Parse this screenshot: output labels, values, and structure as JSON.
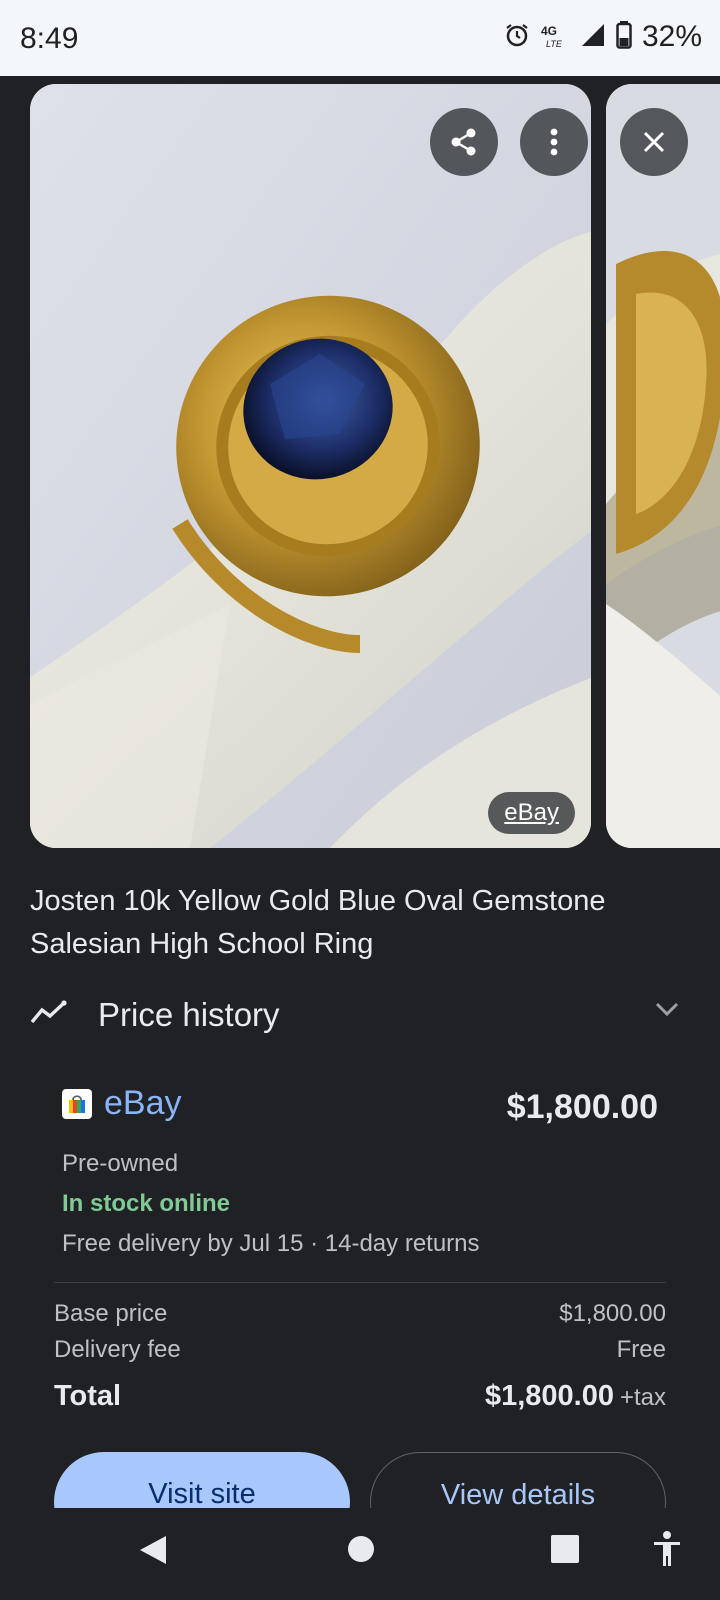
{
  "status_bar": {
    "time": "8:49",
    "network": "4G LTE",
    "battery": "32%",
    "icons": [
      "alarm-icon",
      "lte-icon",
      "signal-icon",
      "battery-icon"
    ]
  },
  "carousel": {
    "badge": "eBay",
    "actions": [
      "share-icon",
      "more-vert-icon",
      "close-icon"
    ]
  },
  "product": {
    "title": "Josten 10k Yellow Gold Blue Oval Gemstone Salesian High School Ring"
  },
  "price_history": {
    "label": "Price history",
    "icon": "trend-icon"
  },
  "offer": {
    "seller": "eBay",
    "price": "$1,800.00",
    "condition": "Pre-owned",
    "stock": "In stock online",
    "delivery": "Free delivery by Jul 15 · 14-day returns",
    "breakdown": {
      "base_label": "Base price",
      "base_value": "$1,800.00",
      "delivery_label": "Delivery fee",
      "delivery_value": "Free",
      "total_label": "Total",
      "total_value": "$1,800.00",
      "tax": "+tax"
    },
    "buttons": {
      "visit": "Visit site",
      "details": "View details"
    }
  },
  "colors": {
    "background": "#202124",
    "link_blue": "#8ab4f8",
    "stock_green": "#81c995",
    "primary_button": "#a8c7fa"
  }
}
